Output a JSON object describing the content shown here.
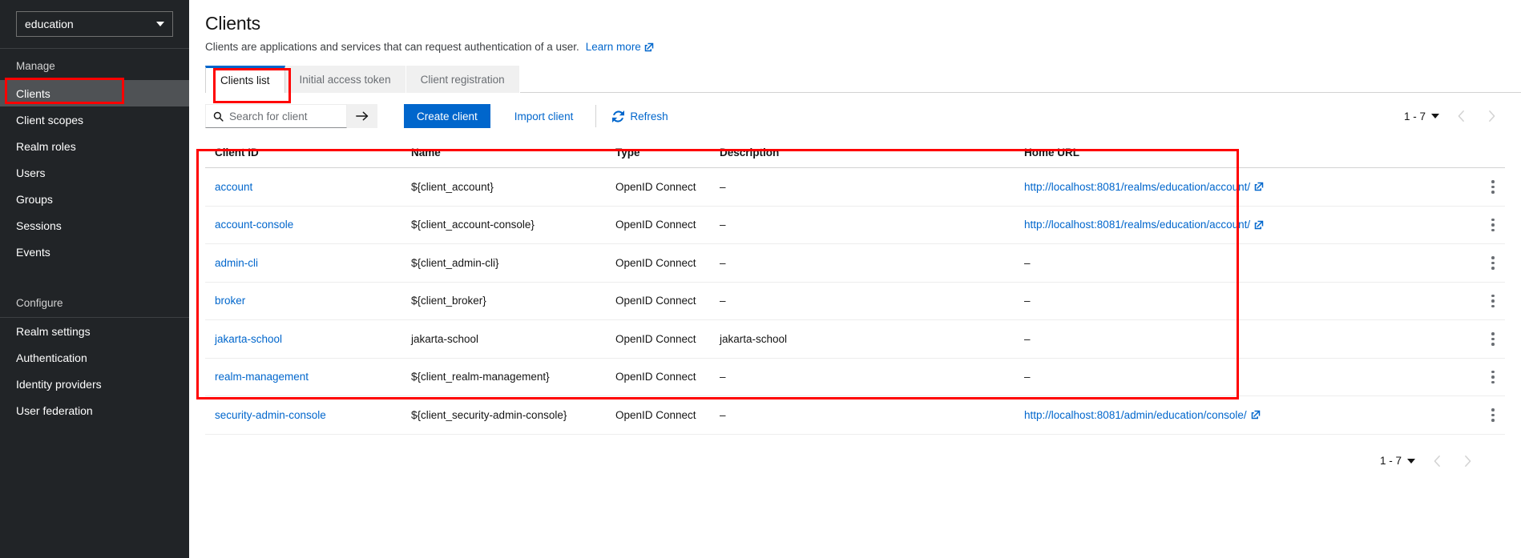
{
  "sidebar": {
    "realm_selector": {
      "value": "education",
      "icon": "chevron-down-icon"
    },
    "manage_label": "Manage",
    "manage_items": [
      {
        "label": "Clients",
        "active": true
      },
      {
        "label": "Client scopes",
        "active": false
      },
      {
        "label": "Realm roles",
        "active": false
      },
      {
        "label": "Users",
        "active": false
      },
      {
        "label": "Groups",
        "active": false
      },
      {
        "label": "Sessions",
        "active": false
      },
      {
        "label": "Events",
        "active": false
      }
    ],
    "configure_label": "Configure",
    "configure_items": [
      {
        "label": "Realm settings",
        "active": false
      },
      {
        "label": "Authentication",
        "active": false
      },
      {
        "label": "Identity providers",
        "active": false
      },
      {
        "label": "User federation",
        "active": false
      }
    ]
  },
  "header": {
    "title": "Clients",
    "subtitle": "Clients are applications and services that can request authentication of a user.",
    "learn_more": "Learn more",
    "learn_more_icon": "external-link-icon"
  },
  "tabs": [
    {
      "label": "Clients list",
      "active": true
    },
    {
      "label": "Initial access token",
      "active": false
    },
    {
      "label": "Client registration",
      "active": false
    }
  ],
  "toolbar": {
    "search_placeholder": "Search for client",
    "search_value": "",
    "search_icon": "search-icon",
    "search_submit_icon": "arrow-right-icon",
    "create_client_label": "Create client",
    "import_client_label": "Import client",
    "refresh_label": "Refresh",
    "refresh_icon": "refresh-icon",
    "pagination": {
      "range": "1 - 7",
      "caret_icon": "chevron-down-icon",
      "prev_icon": "chevron-left-icon",
      "next_icon": "chevron-right-icon"
    }
  },
  "table": {
    "columns": [
      "Client ID",
      "Name",
      "Type",
      "Description",
      "Home URL"
    ],
    "rows": [
      {
        "client_id": "account",
        "name": "${client_account}",
        "type": "OpenID Connect",
        "description": "–",
        "home_url": "http://localhost:8081/realms/education/account/",
        "has_home_url": true
      },
      {
        "client_id": "account-console",
        "name": "${client_account-console}",
        "type": "OpenID Connect",
        "description": "–",
        "home_url": "http://localhost:8081/realms/education/account/",
        "has_home_url": true
      },
      {
        "client_id": "admin-cli",
        "name": "${client_admin-cli}",
        "type": "OpenID Connect",
        "description": "–",
        "home_url": "–",
        "has_home_url": false
      },
      {
        "client_id": "broker",
        "name": "${client_broker}",
        "type": "OpenID Connect",
        "description": "–",
        "home_url": "–",
        "has_home_url": false
      },
      {
        "client_id": "jakarta-school",
        "name": "jakarta-school",
        "type": "OpenID Connect",
        "description": "jakarta-school",
        "home_url": "–",
        "has_home_url": false
      },
      {
        "client_id": "realm-management",
        "name": "${client_realm-management}",
        "type": "OpenID Connect",
        "description": "–",
        "home_url": "–",
        "has_home_url": false
      },
      {
        "client_id": "security-admin-console",
        "name": "${client_security-admin-console}",
        "type": "OpenID Connect",
        "description": "–",
        "home_url": "http://localhost:8081/admin/education/console/",
        "has_home_url": true
      }
    ],
    "footer_pagination": {
      "range": "1 - 7",
      "caret_icon": "chevron-down-icon",
      "prev_icon": "chevron-left-icon",
      "next_icon": "chevron-right-icon"
    }
  },
  "colors": {
    "accent": "#0066cc",
    "sidebar_bg": "#212427",
    "sidebar_active": "#4f5255",
    "annotation": "#ff0000"
  }
}
